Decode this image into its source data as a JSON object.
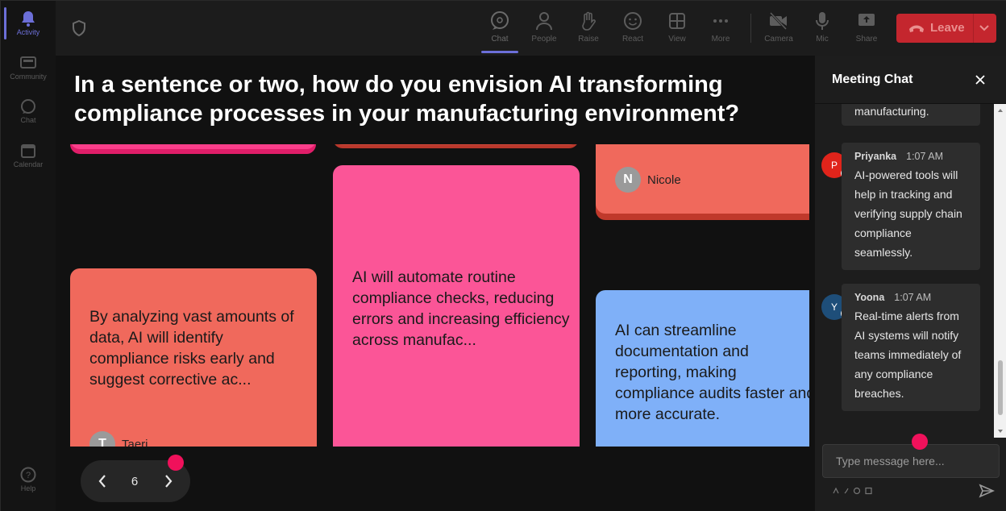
{
  "rail": {
    "items": [
      {
        "label": "Activity",
        "icon": "bell-icon"
      },
      {
        "label": "Community",
        "icon": "community-icon"
      },
      {
        "label": "Chat",
        "icon": "chat-icon"
      },
      {
        "label": "Calendar",
        "icon": "calendar-icon"
      },
      {
        "label": "Help",
        "icon": "help-icon"
      }
    ]
  },
  "toolbar": {
    "chat": "Chat",
    "people": "People",
    "raise": "Raise",
    "react": "React",
    "view": "View",
    "more": "More",
    "camera": "Camera",
    "mic": "Mic",
    "share": "Share",
    "leave": "Leave"
  },
  "stage": {
    "question": "In a sentence or two, how do you envision AI transforming compliance processes in your manufacturing environment?",
    "cards": [
      {
        "text": "By analyzing vast amounts of data, AI will identify compliance risks early and suggest corrective ac...",
        "author": "Taeri",
        "initial": "T",
        "color": "#f0695c"
      },
      {
        "text": "AI will automate routine compliance checks, reducing errors and increasing efficiency across manufac...",
        "color": "#fb5597"
      },
      {
        "text": "AI can streamline documentation and reporting, making compliance audits faster and more accurate.",
        "color": "#7fb0f8"
      },
      {
        "author": "Nicole",
        "initial": "N",
        "color": "#f0695c"
      }
    ],
    "page": "6"
  },
  "chat": {
    "title": "Meeting Chat",
    "partial_text": "manufacturing.",
    "messages": [
      {
        "initial": "P",
        "author": "Priyanka",
        "time": "1:07 AM",
        "text": "AI-powered tools will help in tracking and verifying supply chain compliance seamlessly.",
        "avatar_color": "#e0241b"
      },
      {
        "initial": "Y",
        "author": "Yoona",
        "time": "1:07 AM",
        "text": "Real-time alerts from AI systems will notify teams immediately of any compliance breaches.",
        "avatar_color": "#1e4e79"
      }
    ],
    "placeholder": "Type message here..."
  },
  "colors": {
    "accent": "#6c6fd8",
    "leave": "#c4262e",
    "marker": "#f0115b"
  }
}
